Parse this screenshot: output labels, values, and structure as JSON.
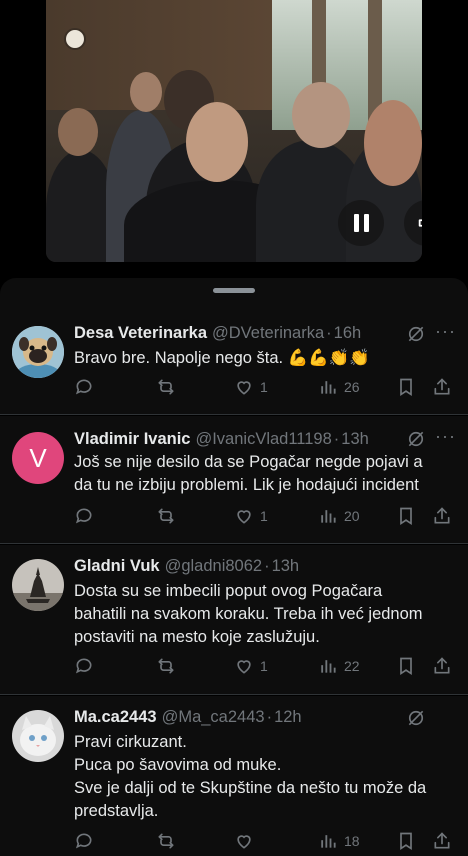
{
  "video": {
    "pause_label": "Pause",
    "sound_label": "Sound"
  },
  "replies": [
    {
      "name": "Desa Veterinarka",
      "handle": "@DVeterinarka",
      "time": "16h",
      "text_lines": [
        "Bravo bre. Napolje nego šta. 💪💪👏👏"
      ],
      "avatar": "pug",
      "likes": "1",
      "views": "26",
      "reposts": ""
    },
    {
      "name": "Vladimir Ivanic",
      "handle": "@IvanicVlad11198",
      "time": "13h",
      "text_lines": [
        "Još se nije desilo da se Pogačar negde pojavi a",
        "da tu ne izbiju problemi. Lik je hodajući incident"
      ],
      "avatar": "letter",
      "avatar_letter": "V",
      "avatar_color": "#e0467c",
      "likes": "1",
      "views": "20",
      "reposts": ""
    },
    {
      "name": "Gladni Vuk",
      "handle": "@gladni8062",
      "time": "13h",
      "text_lines": [
        "Dosta su se imbecili poput ovog Pogačara",
        "bahatili na svakom koraku. Treba ih već jednom",
        "postaviti na mesto koje zaslužuju."
      ],
      "avatar": "wolf",
      "likes": "1",
      "views": "22",
      "reposts": ""
    },
    {
      "name": "Ma.ca2443",
      "handle": "@Ma_ca2443",
      "time": "12h",
      "text_lines": [
        "Pravi cirkuzant.",
        "Puca po šavovima od muke.",
        "Sve je dalji od te Skupštine da nešto tu može da",
        "predstavlja."
      ],
      "avatar": "cat",
      "likes": "",
      "views": "18",
      "reposts": ""
    }
  ],
  "icons": {
    "reply": "comment-icon",
    "repost": "repost-icon",
    "like": "heart-icon",
    "views": "views-icon",
    "bookmark": "bookmark-icon",
    "share": "share-icon",
    "grok": "grok-icon",
    "more": "more-icon"
  },
  "colors": {
    "background": "#000000",
    "card": "#0d0d0d",
    "text": "#e7e9ea",
    "muted": "#71767b",
    "divider": "#2f3336"
  }
}
